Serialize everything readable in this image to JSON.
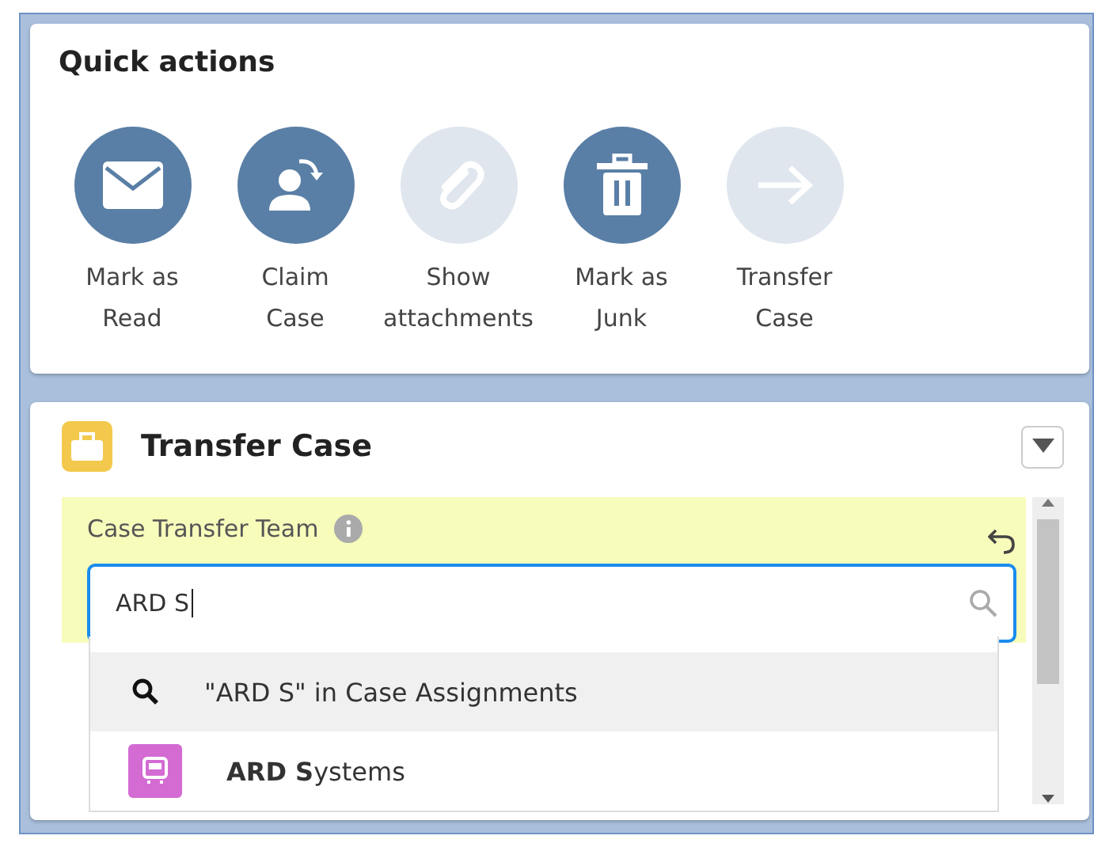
{
  "quick_actions": {
    "title": "Quick actions",
    "actions": [
      {
        "label": "Mark as\nRead",
        "disabled": false
      },
      {
        "label": "Claim\nCase",
        "disabled": false
      },
      {
        "label": "Show\nattachments",
        "disabled": true
      },
      {
        "label": "Mark as\nJunk",
        "disabled": false
      },
      {
        "label": "Transfer\nCase",
        "disabled": true
      }
    ]
  },
  "transfer_panel": {
    "title": "Transfer Case",
    "field": {
      "label": "Case Transfer Team",
      "value": "ARD S"
    },
    "suggestions": [
      {
        "kind": "search",
        "text": "\"ARD S\" in Case Assignments",
        "selected": true
      },
      {
        "kind": "record",
        "text": "**ARD S**ystems",
        "selected": false
      }
    ]
  }
}
